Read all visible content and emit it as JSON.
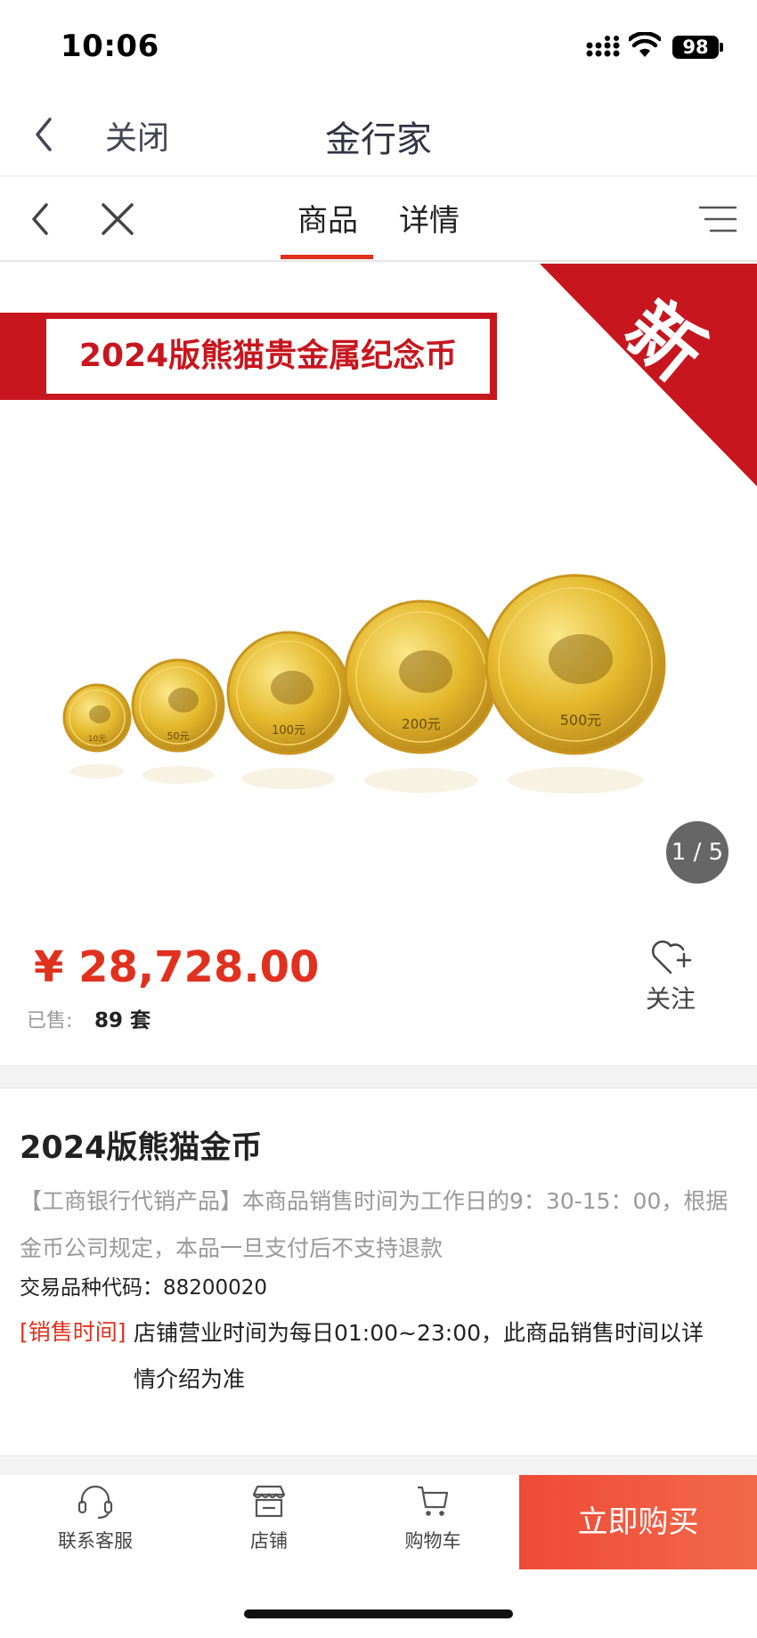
{
  "status_bar": {
    "time": "10:06",
    "battery": "98"
  },
  "nav": {
    "close_label": "关闭",
    "title": "金行家"
  },
  "tabs": [
    {
      "label": "商品",
      "active": true
    },
    {
      "label": "详情",
      "active": false
    }
  ],
  "hero": {
    "banner_text": "2024版熊猫贵金属纪念币",
    "corner_badge": "新",
    "page_indicator": "1 / 5",
    "coin_labels": [
      "10元",
      "50元",
      "100元",
      "200元",
      "500元"
    ]
  },
  "price": {
    "value": "¥ 28,728.00",
    "sold_label": "已售:",
    "sold_count": "89 套"
  },
  "follow": {
    "label": "关注"
  },
  "product": {
    "title": "2024版熊猫金币",
    "description": "【工商银行代销产品】本商品销售时间为工作日的9：30-15：00，根据金币公司规定，本品一旦支付后不支持退款",
    "trade_code": "交易品种代码：88200020",
    "sale_time_label": "[销售时间]",
    "sale_time_text": "店铺营业时间为每日01:00~23:00，此商品销售时间以详情介绍为准"
  },
  "bottom_bar": {
    "service": "联系客服",
    "store": "店铺",
    "cart": "购物车",
    "buy": "立即购买"
  },
  "colors": {
    "accent": "#e0311f",
    "banner_red": "#c7161e",
    "gold": "#e8c23a"
  }
}
